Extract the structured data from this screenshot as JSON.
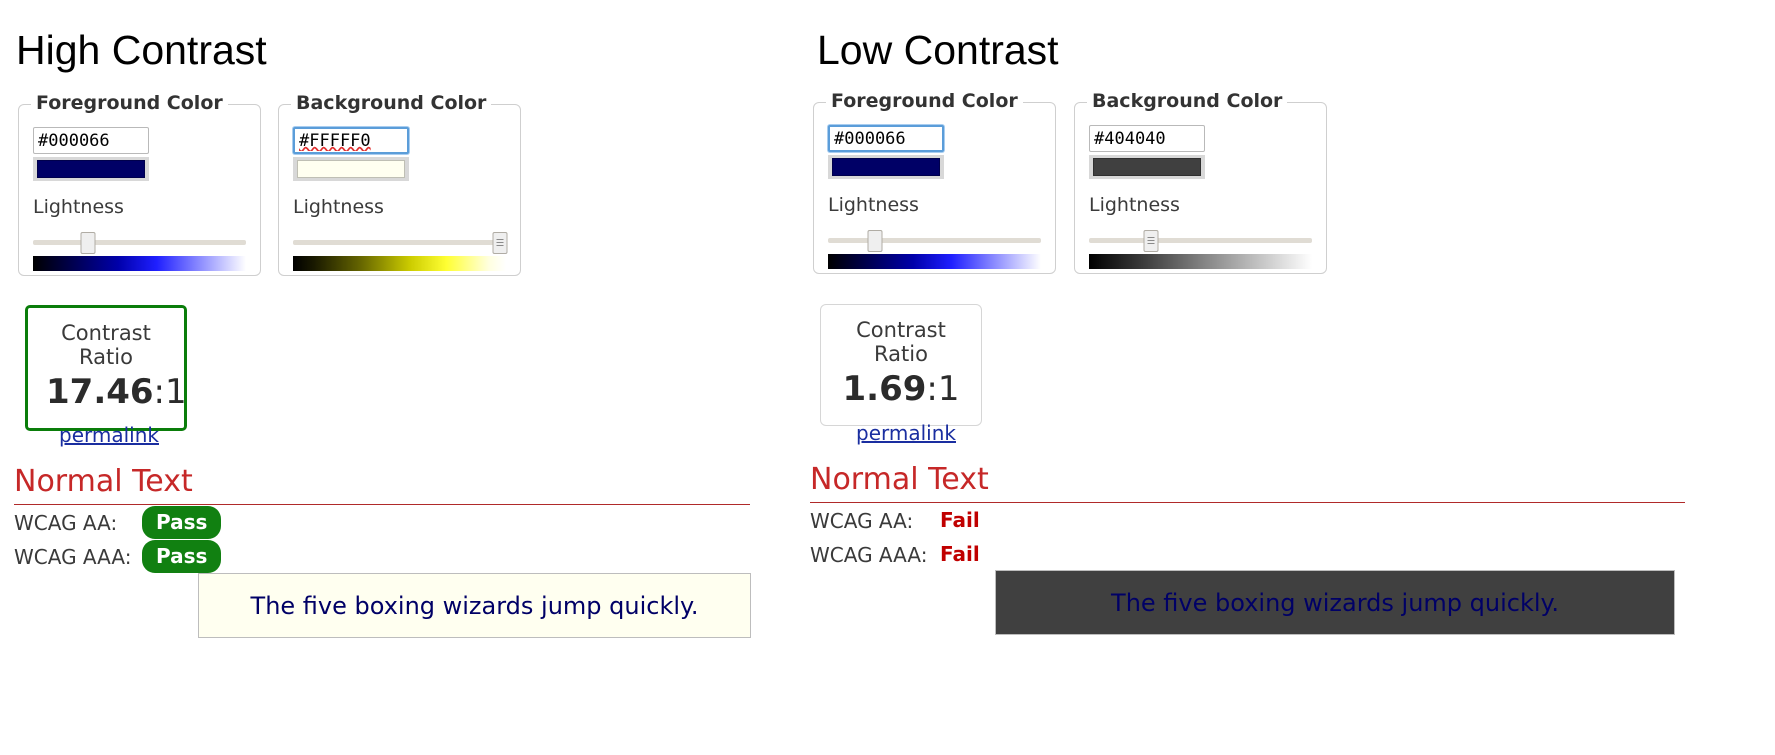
{
  "panels": [
    {
      "id": "high",
      "title": "High Contrast",
      "foreground": {
        "legend": "Foreground Color",
        "hex": "#000066",
        "swatch_color": "#000066",
        "lightness_label": "Lightness",
        "slider_percent": 26,
        "gradient": "linear-gradient(to right, #000000 0%, #000033 12%, #0000aa 40%, #1f1fff 58%, #8080ff 76%, #ffffff 100%)",
        "focused": false,
        "spellcheck_flag": false
      },
      "background": {
        "legend": "Background Color",
        "hex": "#FFFFF0",
        "swatch_color": "#FFFFF0",
        "lightness_label": "Lightness",
        "slider_percent": 97,
        "gradient": "linear-gradient(to right, #000000 0%, #1a1a00 10%, #666600 32%, #cccc00 55%, #ffff33 72%, #ffffe0 92%, #ffffff 100%)",
        "focused": true,
        "spellcheck_flag": true
      },
      "ratio": {
        "label": "Contrast Ratio",
        "value": "17.46",
        "suffix": ":1",
        "pass": true
      },
      "permalink": "permalink",
      "results": {
        "heading": "Normal Text",
        "rows": [
          {
            "key": "WCAG AA:",
            "status": "Pass"
          },
          {
            "key": "WCAG AAA:",
            "status": "Pass"
          }
        ]
      },
      "sample": {
        "text": "The five boxing wizards jump quickly.",
        "bg": "#FFFFF0",
        "fg": "#000066"
      }
    },
    {
      "id": "low",
      "title": "Low Contrast",
      "foreground": {
        "legend": "Foreground Color",
        "hex": "#000066",
        "swatch_color": "#000066",
        "lightness_label": "Lightness",
        "slider_percent": 22,
        "gradient": "linear-gradient(to right, #000000 0%, #000033 12%, #0000aa 40%, #1f1fff 58%, #8080ff 76%, #ffffff 100%)",
        "focused": true,
        "spellcheck_flag": false
      },
      "background": {
        "legend": "Background Color",
        "hex": "#404040",
        "swatch_color": "#404040",
        "lightness_label": "Lightness",
        "slider_percent": 28,
        "gradient": "linear-gradient(to right, #000000 0%, #3d3d3d 25%, #808080 50%, #c0c0c0 75%, #ffffff 100%)",
        "focused": false,
        "spellcheck_flag": false
      },
      "ratio": {
        "label": "Contrast Ratio",
        "value": "1.69",
        "suffix": ":1",
        "pass": false
      },
      "permalink": "permalink",
      "results": {
        "heading": "Normal Text",
        "rows": [
          {
            "key": "WCAG AA:",
            "status": "Fail"
          },
          {
            "key": "WCAG AAA:",
            "status": "Fail"
          }
        ]
      },
      "sample": {
        "text": "The five boxing wizards jump quickly.",
        "bg": "#404040",
        "fg": "#000066"
      }
    }
  ],
  "colors": {
    "pass_green": "#118011",
    "fail_red": "#c00000",
    "heading_red": "#c62828",
    "link_blue": "#1a2ea0"
  }
}
